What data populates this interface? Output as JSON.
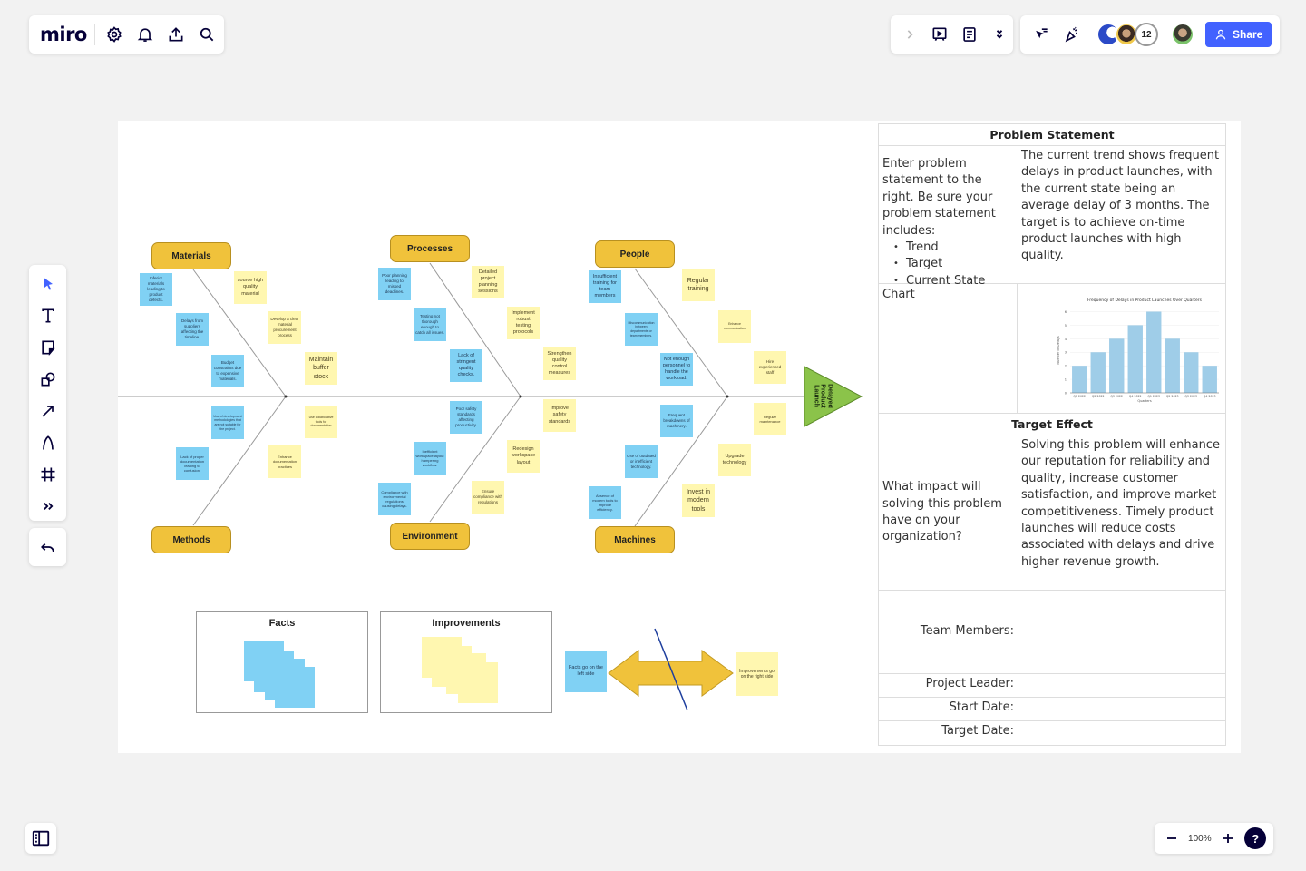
{
  "app": {
    "logo": "miro",
    "share_label": "Share",
    "collaborator_count": "12",
    "zoom_level": "100%",
    "help_label": "?"
  },
  "topbar_left_icons": [
    "gear-icon",
    "bell-icon",
    "upload-icon",
    "search-icon"
  ],
  "topbar_right_icons": [
    "chevron-right-icon",
    "presentation-icon",
    "notes-icon",
    "double-chevron-down-icon",
    "cursor-reaction-icon",
    "celebrate-icon"
  ],
  "toolbar_tools": [
    "select",
    "text",
    "sticky-note",
    "shapes",
    "arrow",
    "pen",
    "frame",
    "more"
  ],
  "colors": {
    "accent": "#4262ff",
    "category_fill": "#f0c23b",
    "sticky_blue": "#80d1f4",
    "sticky_yellow": "#fff7b0",
    "head_green": "#8bc34a",
    "chart_bar": "#9fcde8"
  },
  "fishbone": {
    "head": "Delayed Product Launch",
    "categories": [
      {
        "name": "Materials",
        "causes": [
          "Inferior materials leading to product defects.",
          "Delays from suppliers affecting the timeline.",
          "Budget constraints due to expensive materials."
        ],
        "improvements": [
          "source high quality material",
          "Develop a clear material procurement process",
          "Maintain buffer stock"
        ]
      },
      {
        "name": "Processes",
        "causes": [
          "Poor planning leading to missed deadlines.",
          "Testing not thorough enough to catch all issues.",
          "Lack of stringent quality checks."
        ],
        "improvements": [
          "Detailed project planning sessions",
          "Implement robust testing protocols",
          "Strengthen quality control measures"
        ]
      },
      {
        "name": "People",
        "causes": [
          "Insufficient training for team members",
          "Miscommunication between departments or team members.",
          "Not enough personnel to handle the workload."
        ],
        "improvements": [
          "Regular training",
          "Enhance communication",
          "Hire experienced staff"
        ]
      },
      {
        "name": "Methods",
        "causes": [
          "Use of development methodologies that are not suitable for the project.",
          "Lack of proper documentation leading to confusion."
        ],
        "improvements": [
          "Use collaborative tools for documentation",
          "Enhance documentation practices"
        ]
      },
      {
        "name": "Environment",
        "causes": [
          "Poor safety standards affecting productivity.",
          "Inefficient workspace layout hampering workflow.",
          "Compliance with environmental regulations causing delays."
        ],
        "improvements": [
          "Improve safety standards",
          "Redesign workspace layout",
          "Ensure compliance with regulations"
        ]
      },
      {
        "name": "Machines",
        "causes": [
          "Frequent breakdowns of machinery.",
          "Use of outdated or inefficient technology.",
          "Absence of modern tools to improve efficiency."
        ],
        "improvements": [
          "Regular maintenance",
          "Upgrade technology",
          "Invest in modern tools"
        ]
      }
    ]
  },
  "legend": {
    "facts_title": "Facts",
    "improvements_title": "Improvements",
    "facts_note": "Facts go on the left side",
    "improvements_note": "Improvements go on the right side"
  },
  "table": {
    "problem_header": "Problem Statement",
    "problem_prompt": "Enter problem statement to the right. Be sure your problem statement includes:",
    "problem_bullets": [
      "Trend",
      "Target",
      "Current State"
    ],
    "problem_text": "The current trend shows frequent delays in product launches, with the current state being an average delay of 3 months. The target is to achieve on-time product launches with high quality.",
    "chart_label": "Chart",
    "target_header": "Target Effect",
    "target_prompt": "What impact will solving this problem have on your organization?",
    "target_text": "Solving this problem will enhance our reputation for reliability and quality, increase customer satisfaction, and improve market competitiveness. Timely product launches will reduce costs associated with delays and drive higher revenue growth.",
    "team_members_label": "Team Members:",
    "team_members_value": "",
    "project_leader_label": "Project Leader:",
    "project_leader_value": "",
    "start_date_label": "Start Date:",
    "start_date_value": "",
    "target_date_label": "Target Date:",
    "target_date_value": ""
  },
  "chart_data": {
    "type": "bar",
    "title": "Frequency of Delays in Product Launches Over Quarters",
    "xlabel": "Quarters",
    "ylabel": "Number of Delays",
    "categories": [
      "Q1 2022",
      "Q2 2022",
      "Q3 2022",
      "Q4 2022",
      "Q1 2023",
      "Q2 2023",
      "Q3 2023",
      "Q4 2023"
    ],
    "values": [
      2,
      3,
      4,
      5,
      6,
      4,
      3,
      2
    ],
    "yticks": [
      0,
      1,
      2,
      3,
      4,
      5,
      6
    ],
    "ylim": [
      0,
      6.3
    ],
    "grid": true
  }
}
